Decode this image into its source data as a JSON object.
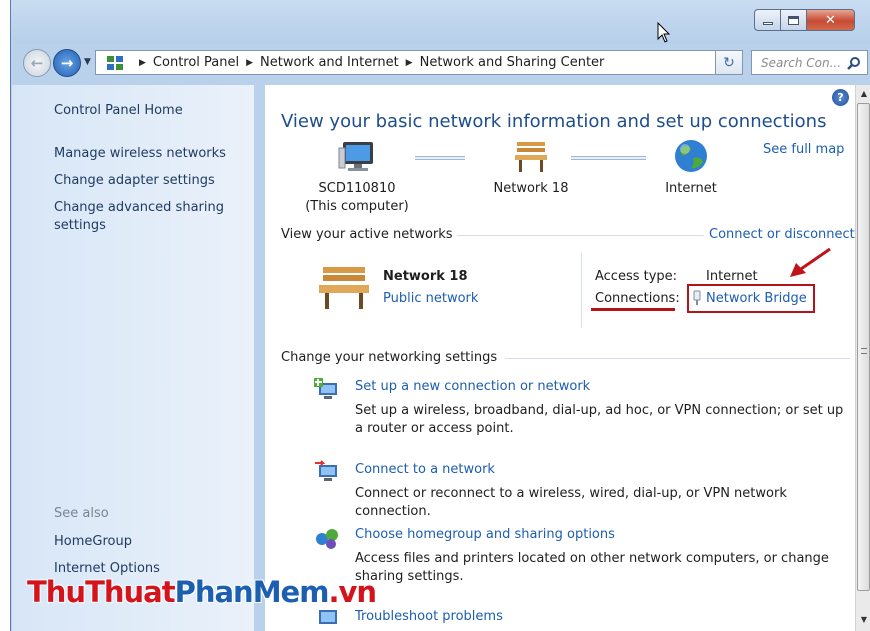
{
  "window": {
    "controls": {
      "minimize_icon": "minimize-icon",
      "maximize_icon": "maximize-icon",
      "close_label": "✕"
    }
  },
  "navigation": {
    "back_icon": "back-arrow-icon",
    "forward_icon": "forward-arrow-icon",
    "breadcrumbs": [
      "Control Panel",
      "Network and Internet",
      "Network and Sharing Center"
    ],
    "search_placeholder": "Search Con..."
  },
  "sidebar": {
    "links": [
      "Control Panel Home",
      "Manage wireless networks",
      "Change adapter settings",
      "Change advanced sharing settings"
    ],
    "see_also_heading": "See also",
    "see_also_links": [
      "HomeGroup",
      "Internet Options"
    ]
  },
  "main": {
    "help_label": "?",
    "title": "View your basic network information and set up connections",
    "see_full_map": "See full map",
    "map": {
      "computer_name": "SCD110810",
      "computer_sub": "(This computer)",
      "network_name": "Network  18",
      "internet_name": "Internet"
    },
    "active_networks_heading": "View your active networks",
    "connect_or_disconnect": "Connect or disconnect",
    "active_network": {
      "name": "Network  18",
      "type": "Public network",
      "access_type_label": "Access type:",
      "access_type_value": "Internet",
      "connections_label": "Connections:",
      "connections_value": "Network Bridge"
    },
    "change_settings_heading": "Change your networking settings",
    "tasks": [
      {
        "title": "Set up a new connection or network",
        "desc": "Set up a wireless, broadband, dial-up, ad hoc, or VPN connection; or set up a router or access point."
      },
      {
        "title": "Connect to a network",
        "desc": "Connect or reconnect to a wireless, wired, dial-up, or VPN network connection."
      },
      {
        "title": "Choose homegroup and sharing options",
        "desc": "Access files and printers located on other network computers, or change sharing settings."
      },
      {
        "title": "Troubleshoot problems",
        "desc": ""
      }
    ]
  },
  "annotations": {
    "highlight_color": "#b5121b"
  },
  "watermark": {
    "part1": "ThuThuat",
    "part2": "PhanMem",
    "part3": ".vn"
  }
}
